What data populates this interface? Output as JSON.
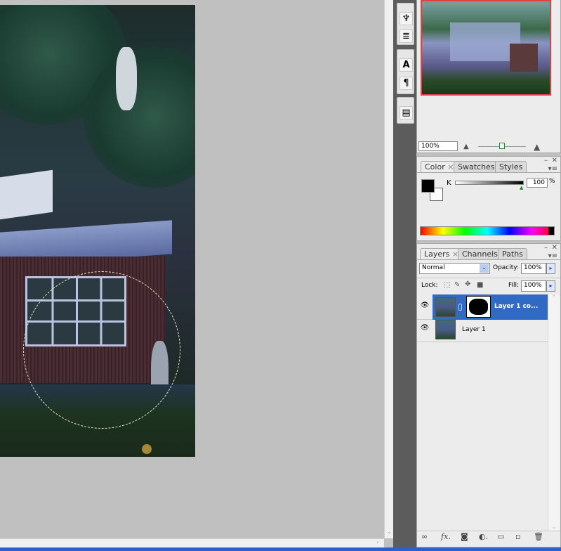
{
  "navigator": {
    "zoom_value": "100%"
  },
  "toolbar_icons": [
    "clone-source-icon",
    "tool-presets-icon",
    "character-icon",
    "paragraph-icon",
    "layer-comps-icon"
  ],
  "color_panel": {
    "tabs": [
      "Color",
      "Swatches",
      "Styles"
    ],
    "channel_label": "K",
    "value": "100",
    "unit": "%",
    "foreground": "#000000",
    "background": "#ffffff"
  },
  "layers_panel": {
    "tabs": [
      "Layers",
      "Channels",
      "Paths"
    ],
    "blend_mode": "Normal",
    "opacity_label": "Opacity:",
    "opacity": "100%",
    "lock_label": "Lock:",
    "fill_label": "Fill:",
    "fill": "100%",
    "layers": [
      {
        "name": "Layer 1 co...",
        "selected": true,
        "has_mask": true
      },
      {
        "name": "Layer 1",
        "selected": false,
        "has_mask": false
      }
    ],
    "selection_color": "#316ac5"
  }
}
